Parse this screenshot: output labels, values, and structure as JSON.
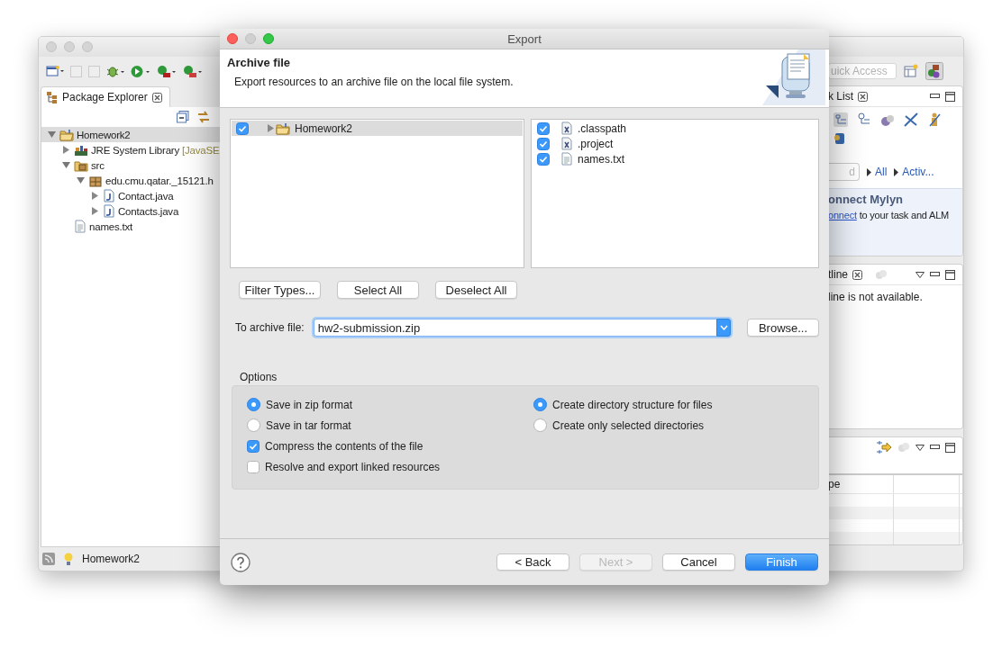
{
  "workbench": {
    "quick_access": {
      "placeholder": "uick Access"
    },
    "package_explorer": {
      "tab": "Package Explorer",
      "tree": [
        {
          "kind": "project",
          "label": "Homework2",
          "expanded": true,
          "selected": true,
          "children": [
            {
              "kind": "library",
              "label": "JRE System Library",
              "suffix": "[JavaSE",
              "expanded": false,
              "selected": false
            },
            {
              "kind": "source-folder",
              "label": "src",
              "expanded": true,
              "selected": false,
              "children": [
                {
                  "kind": "package",
                  "label": "edu.cmu.qatar._15121.h",
                  "expanded": true,
                  "selected": false,
                  "children": [
                    {
                      "kind": "java",
                      "label": "Contact.java",
                      "expanded": false,
                      "selected": false
                    },
                    {
                      "kind": "java",
                      "label": "Contacts.java",
                      "expanded": false,
                      "selected": false
                    }
                  ]
                }
              ]
            },
            {
              "kind": "text",
              "label": "names.txt",
              "selected": false
            }
          ]
        }
      ]
    },
    "status_bar": {
      "text": "Homework2"
    },
    "task_list": {
      "tab": "k List",
      "find_placeholder": "d",
      "filters": [
        "All",
        "Activ..."
      ]
    },
    "connect_mylyn": {
      "title": "onnect Mylyn",
      "link": "onnect",
      "text": "to your task and ALM"
    },
    "outline": {
      "tab": "tline",
      "message": "line is not available."
    },
    "table": {
      "columns": [
        "pe"
      ]
    }
  },
  "dialog": {
    "title": "Export",
    "header": {
      "title": "Archive file",
      "description": "Export resources to an archive file on the local file system."
    },
    "resources": [
      {
        "kind": "project",
        "label": "Homework2",
        "checked": true,
        "expanded": false,
        "selected": true
      }
    ],
    "files": [
      {
        "kind": "xml",
        "label": ".classpath",
        "checked": true
      },
      {
        "kind": "xml",
        "label": ".project",
        "checked": true
      },
      {
        "kind": "text",
        "label": "names.txt",
        "checked": true
      }
    ],
    "selection_buttons": [
      "Filter Types...",
      "Select All",
      "Deselect All"
    ],
    "archive": {
      "label": "To archive file:",
      "value": "hw2-submission.zip",
      "browse": "Browse..."
    },
    "options": {
      "title": "Options",
      "left": [
        {
          "kind": "radio",
          "label": "Save in zip format",
          "selected": true
        },
        {
          "kind": "radio",
          "label": "Save in tar format",
          "selected": false
        },
        {
          "kind": "checkbox",
          "label": "Compress the contents of the file",
          "checked": true
        },
        {
          "kind": "checkbox",
          "label": "Resolve and export linked resources",
          "checked": false
        }
      ],
      "right": [
        {
          "kind": "radio",
          "label": "Create directory structure for files",
          "selected": true
        },
        {
          "kind": "radio",
          "label": "Create only selected directories",
          "selected": false
        }
      ]
    },
    "buttons": [
      {
        "label": "< Back",
        "disabled": false,
        "default": false
      },
      {
        "label": "Next >",
        "disabled": true,
        "default": false
      },
      {
        "label": "Cancel",
        "disabled": false,
        "default": false
      },
      {
        "label": "Finish",
        "disabled": false,
        "default": true
      }
    ]
  }
}
